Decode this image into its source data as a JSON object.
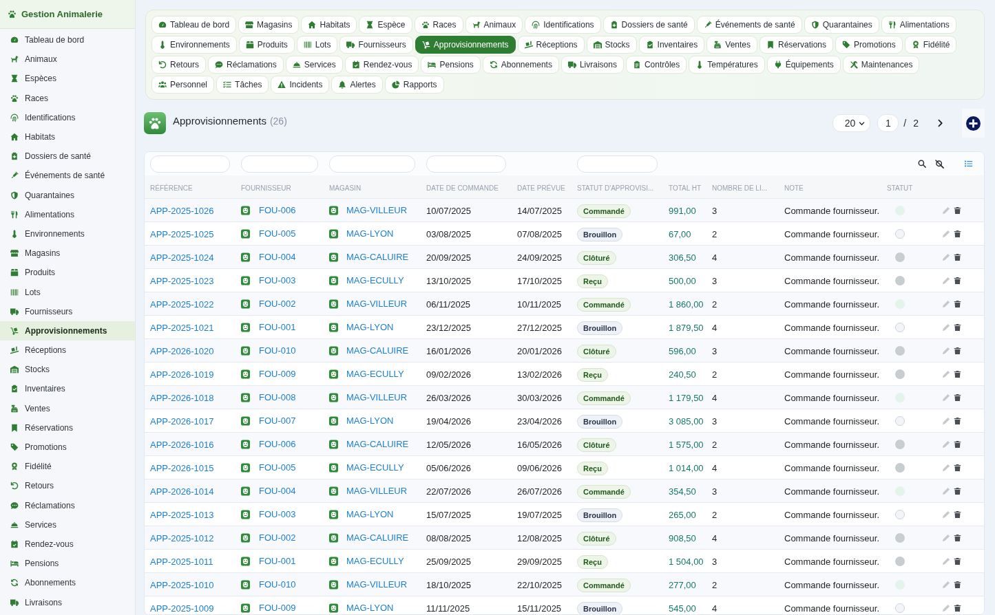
{
  "sidebar": {
    "title": "Gestion Animalerie",
    "items": [
      {
        "label": "Tableau de bord",
        "selected": false
      },
      {
        "label": "Animaux",
        "selected": false
      },
      {
        "label": "Espèces",
        "selected": false
      },
      {
        "label": "Races",
        "selected": false
      },
      {
        "label": "Identifications",
        "selected": false
      },
      {
        "label": "Habitats",
        "selected": false
      },
      {
        "label": "Dossiers de santé",
        "selected": false
      },
      {
        "label": "Événements de santé",
        "selected": false
      },
      {
        "label": "Quarantaines",
        "selected": false
      },
      {
        "label": "Alimentations",
        "selected": false
      },
      {
        "label": "Environnements",
        "selected": false
      },
      {
        "label": "Magasins",
        "selected": false
      },
      {
        "label": "Produits",
        "selected": false
      },
      {
        "label": "Lots",
        "selected": false
      },
      {
        "label": "Fournisseurs",
        "selected": false
      },
      {
        "label": "Approvisionnements",
        "selected": true
      },
      {
        "label": "Réceptions",
        "selected": false
      },
      {
        "label": "Stocks",
        "selected": false
      },
      {
        "label": "Inventaires",
        "selected": false
      },
      {
        "label": "Ventes",
        "selected": false
      },
      {
        "label": "Réservations",
        "selected": false
      },
      {
        "label": "Promotions",
        "selected": false
      },
      {
        "label": "Fidélité",
        "selected": false
      },
      {
        "label": "Retours",
        "selected": false
      },
      {
        "label": "Réclamations",
        "selected": false
      },
      {
        "label": "Services",
        "selected": false
      },
      {
        "label": "Rendez-vous",
        "selected": false
      },
      {
        "label": "Pensions",
        "selected": false
      },
      {
        "label": "Abonnements",
        "selected": false
      },
      {
        "label": "Livraisons",
        "selected": false
      }
    ]
  },
  "nav_tabs": [
    {
      "label": "Tableau de bord",
      "selected": false
    },
    {
      "label": "Magasins",
      "selected": false
    },
    {
      "label": "Habitats",
      "selected": false
    },
    {
      "label": "Espèce",
      "selected": false
    },
    {
      "label": "Races",
      "selected": false
    },
    {
      "label": "Animaux",
      "selected": false
    },
    {
      "label": "Identifications",
      "selected": false
    },
    {
      "label": "Dossiers de santé",
      "selected": false
    },
    {
      "label": "Événements de santé",
      "selected": false
    },
    {
      "label": "Quarantaines",
      "selected": false
    },
    {
      "label": "Alimentations",
      "selected": false
    },
    {
      "label": "Environnements",
      "selected": false
    },
    {
      "label": "Produits",
      "selected": false
    },
    {
      "label": "Lots",
      "selected": false
    },
    {
      "label": "Fournisseurs",
      "selected": false
    },
    {
      "label": "Approvisionnements",
      "selected": true
    },
    {
      "label": "Réceptions",
      "selected": false
    },
    {
      "label": "Stocks",
      "selected": false
    },
    {
      "label": "Inventaires",
      "selected": false
    },
    {
      "label": "Ventes",
      "selected": false
    },
    {
      "label": "Réservations",
      "selected": false
    },
    {
      "label": "Promotions",
      "selected": false
    },
    {
      "label": "Fidélité",
      "selected": false
    },
    {
      "label": "Retours",
      "selected": false
    },
    {
      "label": "Réclamations",
      "selected": false
    },
    {
      "label": "Services",
      "selected": false
    },
    {
      "label": "Rendez-vous",
      "selected": false
    },
    {
      "label": "Pensions",
      "selected": false
    },
    {
      "label": "Abonnements",
      "selected": false
    },
    {
      "label": "Livraisons",
      "selected": false
    },
    {
      "label": "Contrôles",
      "selected": false
    },
    {
      "label": "Températures",
      "selected": false
    },
    {
      "label": "Équipements",
      "selected": false
    },
    {
      "label": "Maintenances",
      "selected": false
    },
    {
      "label": "Personnel",
      "selected": false
    },
    {
      "label": "Tâches",
      "selected": false
    },
    {
      "label": "Incidents",
      "selected": false
    },
    {
      "label": "Alertes",
      "selected": false
    },
    {
      "label": "Rapports",
      "selected": false
    }
  ],
  "page_header": {
    "title": "Approvisionnements",
    "count": "(26)",
    "page_size": "20",
    "page": "1",
    "separator": "/",
    "page_count": "2"
  },
  "table": {
    "columns": [
      {
        "label": "RÉFÉRENCE",
        "filter": true
      },
      {
        "label": "FOURNISSEUR",
        "filter": true
      },
      {
        "label": "MAGASIN",
        "filter": true
      },
      {
        "label": "DATE DE COMMANDE",
        "filter": true
      },
      {
        "label": "DATE PRÉVUE",
        "filter": false
      },
      {
        "label": "STATUT D'APPROVISI...",
        "filter": true
      },
      {
        "label": "TOTAL HT",
        "filter": false
      },
      {
        "label": "NOMBRE DE LI...",
        "filter": false
      },
      {
        "label": "NOTE",
        "filter": false
      },
      {
        "label": "STATUT",
        "filter": false
      }
    ],
    "rows": [
      {
        "reference": "APP-2025-1026",
        "supplier": "FOU-006",
        "store": "MAG-VILLEUR",
        "order_date": "10/07/2025",
        "expected_date": "14/07/2025",
        "supply_status": {
          "label": "Commandé",
          "kind": "success"
        },
        "total_ht": "991,00",
        "line_count": "3",
        "note": "Commande fournisseur.",
        "status": {
          "color": "#e3f5eb"
        }
      },
      {
        "reference": "APP-2025-1025",
        "supplier": "FOU-005",
        "store": "MAG-LYON",
        "order_date": "03/08/2025",
        "expected_date": "07/08/2025",
        "supply_status": {
          "label": "Brouillon",
          "kind": "neutral"
        },
        "total_ht": "67,00",
        "line_count": "2",
        "note": "Commande fournisseur.",
        "status": {
          "color": "#f3f5f8"
        }
      },
      {
        "reference": "APP-2025-1024",
        "supplier": "FOU-004",
        "store": "MAG-CALUIRE",
        "order_date": "20/09/2025",
        "expected_date": "24/09/2025",
        "supply_status": {
          "label": "Clôturé",
          "kind": "success"
        },
        "total_ht": "306,50",
        "line_count": "4",
        "note": "Commande fournisseur.",
        "status": {
          "color": "#c8cecf"
        }
      },
      {
        "reference": "APP-2025-1023",
        "supplier": "FOU-003",
        "store": "MAG-ECULLY",
        "order_date": "13/10/2025",
        "expected_date": "17/10/2025",
        "supply_status": {
          "label": "Reçu",
          "kind": "success"
        },
        "total_ht": "500,00",
        "line_count": "3",
        "note": "Commande fournisseur.",
        "status": {
          "color": "#c8cecf"
        }
      },
      {
        "reference": "APP-2025-1022",
        "supplier": "FOU-002",
        "store": "MAG-VILLEUR",
        "order_date": "06/11/2025",
        "expected_date": "10/11/2025",
        "supply_status": {
          "label": "Commandé",
          "kind": "success"
        },
        "total_ht": "1 860,00",
        "line_count": "2",
        "note": "Commande fournisseur.",
        "status": {
          "color": "#e3f5eb"
        }
      },
      {
        "reference": "APP-2025-1021",
        "supplier": "FOU-001",
        "store": "MAG-LYON",
        "order_date": "23/12/2025",
        "expected_date": "27/12/2025",
        "supply_status": {
          "label": "Brouillon",
          "kind": "neutral"
        },
        "total_ht": "1 879,50",
        "line_count": "4",
        "note": "Commande fournisseur.",
        "status": {
          "color": "#f3f5f8"
        }
      },
      {
        "reference": "APP-2026-1020",
        "supplier": "FOU-010",
        "store": "MAG-CALUIRE",
        "order_date": "16/01/2026",
        "expected_date": "20/01/2026",
        "supply_status": {
          "label": "Clôturé",
          "kind": "success"
        },
        "total_ht": "596,00",
        "line_count": "3",
        "note": "Commande fournisseur.",
        "status": {
          "color": "#c8cecf"
        }
      },
      {
        "reference": "APP-2026-1019",
        "supplier": "FOU-009",
        "store": "MAG-ECULLY",
        "order_date": "09/02/2026",
        "expected_date": "13/02/2026",
        "supply_status": {
          "label": "Reçu",
          "kind": "success"
        },
        "total_ht": "240,50",
        "line_count": "2",
        "note": "Commande fournisseur.",
        "status": {
          "color": "#c8cecf"
        }
      },
      {
        "reference": "APP-2026-1018",
        "supplier": "FOU-008",
        "store": "MAG-VILLEUR",
        "order_date": "26/03/2026",
        "expected_date": "30/03/2026",
        "supply_status": {
          "label": "Commandé",
          "kind": "success"
        },
        "total_ht": "1 179,50",
        "line_count": "4",
        "note": "Commande fournisseur.",
        "status": {
          "color": "#e3f5eb"
        }
      },
      {
        "reference": "APP-2026-1017",
        "supplier": "FOU-007",
        "store": "MAG-LYON",
        "order_date": "19/04/2026",
        "expected_date": "23/04/2026",
        "supply_status": {
          "label": "Brouillon",
          "kind": "neutral"
        },
        "total_ht": "3 085,00",
        "line_count": "3",
        "note": "Commande fournisseur.",
        "status": {
          "color": "#f3f5f8"
        }
      },
      {
        "reference": "APP-2026-1016",
        "supplier": "FOU-006",
        "store": "MAG-CALUIRE",
        "order_date": "12/05/2026",
        "expected_date": "16/05/2026",
        "supply_status": {
          "label": "Clôturé",
          "kind": "success"
        },
        "total_ht": "1 575,00",
        "line_count": "2",
        "note": "Commande fournisseur.",
        "status": {
          "color": "#c8cecf"
        }
      },
      {
        "reference": "APP-2026-1015",
        "supplier": "FOU-005",
        "store": "MAG-ECULLY",
        "order_date": "05/06/2026",
        "expected_date": "09/06/2026",
        "supply_status": {
          "label": "Reçu",
          "kind": "success"
        },
        "total_ht": "1 014,00",
        "line_count": "4",
        "note": "Commande fournisseur.",
        "status": {
          "color": "#c8cecf"
        }
      },
      {
        "reference": "APP-2026-1014",
        "supplier": "FOU-004",
        "store": "MAG-VILLEUR",
        "order_date": "22/07/2026",
        "expected_date": "26/07/2026",
        "supply_status": {
          "label": "Commandé",
          "kind": "success"
        },
        "total_ht": "354,50",
        "line_count": "3",
        "note": "Commande fournisseur.",
        "status": {
          "color": "#e3f5eb"
        }
      },
      {
        "reference": "APP-2025-1013",
        "supplier": "FOU-003",
        "store": "MAG-LYON",
        "order_date": "15/07/2025",
        "expected_date": "19/07/2025",
        "supply_status": {
          "label": "Brouillon",
          "kind": "neutral"
        },
        "total_ht": "265,00",
        "line_count": "2",
        "note": "Commande fournisseur.",
        "status": {
          "color": "#f3f5f8"
        }
      },
      {
        "reference": "APP-2025-1012",
        "supplier": "FOU-002",
        "store": "MAG-CALUIRE",
        "order_date": "08/08/2025",
        "expected_date": "12/08/2025",
        "supply_status": {
          "label": "Clôturé",
          "kind": "success"
        },
        "total_ht": "908,50",
        "line_count": "4",
        "note": "Commande fournisseur.",
        "status": {
          "color": "#c8cecf"
        }
      },
      {
        "reference": "APP-2025-1011",
        "supplier": "FOU-001",
        "store": "MAG-ECULLY",
        "order_date": "25/09/2025",
        "expected_date": "29/09/2025",
        "supply_status": {
          "label": "Reçu",
          "kind": "success"
        },
        "total_ht": "1 504,00",
        "line_count": "3",
        "note": "Commande fournisseur.",
        "status": {
          "color": "#c8cecf"
        }
      },
      {
        "reference": "APP-2025-1010",
        "supplier": "FOU-010",
        "store": "MAG-VILLEUR",
        "order_date": "18/10/2025",
        "expected_date": "22/10/2025",
        "supply_status": {
          "label": "Commandé",
          "kind": "success"
        },
        "total_ht": "277,00",
        "line_count": "2",
        "note": "Commande fournisseur.",
        "status": {
          "color": "#e3f5eb"
        }
      },
      {
        "reference": "APP-2025-1009",
        "supplier": "FOU-009",
        "store": "MAG-LYON",
        "order_date": "11/11/2025",
        "expected_date": "15/11/2025",
        "supply_status": {
          "label": "Brouillon",
          "kind": "neutral"
        },
        "total_ht": "545,00",
        "line_count": "4",
        "note": "Commande fournisseur.",
        "status": {
          "color": "#f3f5f8"
        }
      }
    ]
  }
}
